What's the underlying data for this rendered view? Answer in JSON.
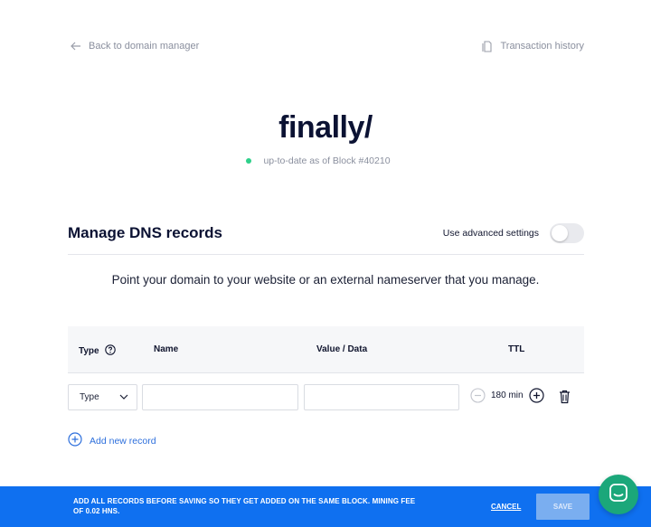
{
  "nav": {
    "back_label": "Back to domain manager",
    "history_label": "Transaction history"
  },
  "domain": {
    "name": "finally/",
    "status": "up-to-date as of Block #40210",
    "status_color": "#2ed08a"
  },
  "manage": {
    "title": "Manage DNS records",
    "advanced_label": "Use advanced settings",
    "advanced_enabled": false,
    "description": "Point your domain to your website or an external nameserver that you manage."
  },
  "table": {
    "headers": {
      "type": "Type",
      "name": "Name",
      "value": "Value / Data",
      "ttl": "TTL"
    },
    "rows": [
      {
        "type": "Type",
        "name": "",
        "value": "",
        "ttl": "180 min"
      }
    ]
  },
  "add_record_label": "Add new record",
  "footer": {
    "message": "Add all records before saving so they get added on the same block. Mining fee of 0.02 HNS.",
    "cancel_label": "CANCEL",
    "save_label": "SAVE"
  },
  "colors": {
    "accent": "#0f70f0",
    "link": "#2d6fdc",
    "chat": "#1ba77a"
  },
  "icons": [
    "arrow-left-icon",
    "document-icon",
    "help-circle-icon",
    "chevron-down-icon",
    "minus-circle-icon",
    "plus-circle-icon",
    "trash-icon",
    "chat-icon"
  ]
}
